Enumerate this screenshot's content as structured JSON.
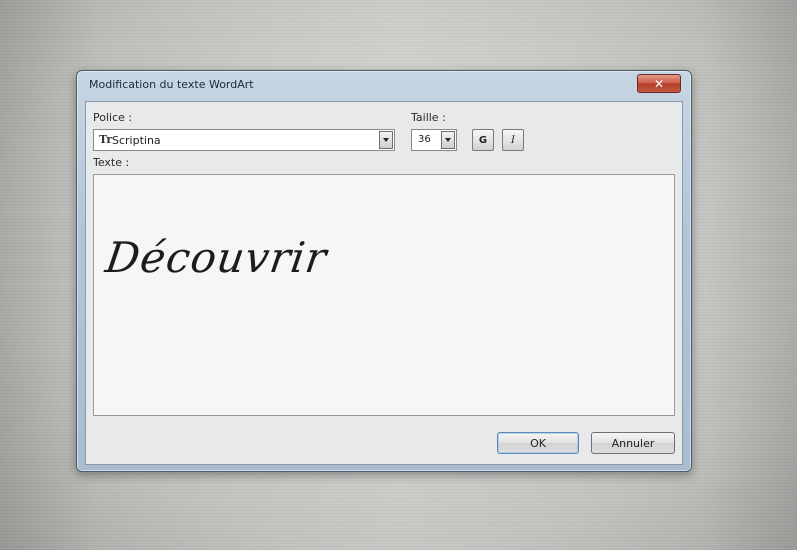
{
  "dialog": {
    "title": "Modification du texte WordArt",
    "close_label": "✕"
  },
  "font": {
    "label": "Police :",
    "icon": "truetype-font-icon",
    "icon_glyph": "Tr",
    "value": "Scriptina"
  },
  "size": {
    "label": "Taille :",
    "value": "36"
  },
  "format": {
    "bold_label": "G",
    "italic_label": "I"
  },
  "text": {
    "label": "Texte :",
    "value": "Découvrir"
  },
  "buttons": {
    "ok_label": "OK",
    "cancel_label": "Annuler"
  }
}
